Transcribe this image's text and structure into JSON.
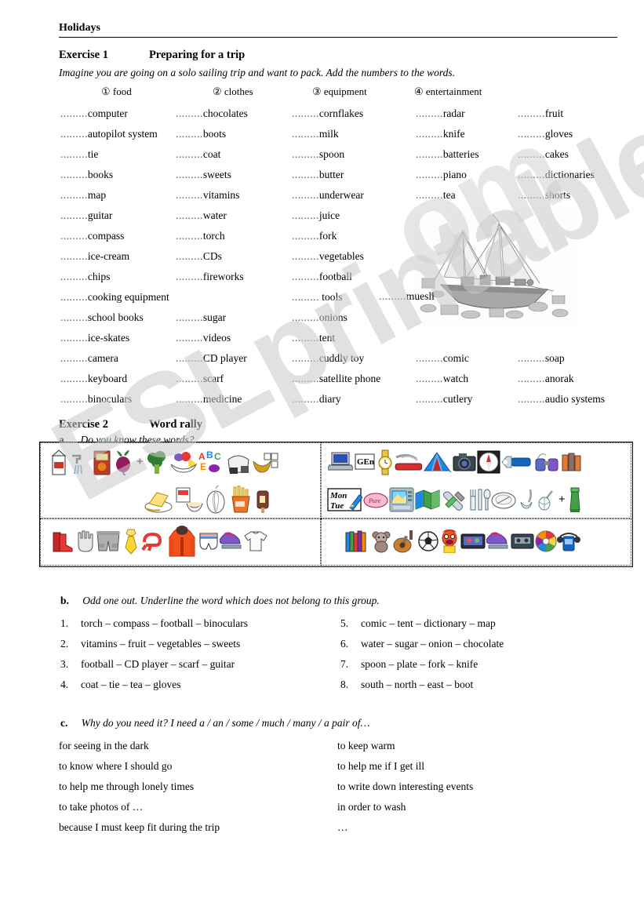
{
  "header": {
    "title": "Holidays"
  },
  "exercise1": {
    "label": "Exercise 1",
    "title": "Preparing for a trip",
    "instruction": "Imagine you are going on a solo sailing trip and want to pack.  Add the numbers to the words.",
    "categories": [
      {
        "num": "①",
        "label": "food"
      },
      {
        "num": "②",
        "label": "clothes"
      },
      {
        "num": "③",
        "label": "equipment"
      },
      {
        "num": "④",
        "label": "entertainment"
      }
    ],
    "dots": ".........",
    "columns": [
      [
        "computer",
        "autopilot system",
        "tie",
        "books",
        "map",
        "guitar",
        "compass",
        "ice-cream",
        "chips",
        "cooking equipment",
        "school books",
        "ice-skates",
        "camera",
        "keyboard",
        "binoculars"
      ],
      [
        "chocolates",
        "boots",
        "coat",
        "sweets",
        "vitamins",
        "water",
        "torch",
        "CDs",
        "fireworks",
        "",
        "sugar",
        "videos",
        "CD player",
        "scarf",
        "medicine"
      ],
      [
        "cornflakes",
        "milk",
        "spoon",
        "butter",
        "underwear",
        "juice",
        "fork",
        "vegetables",
        "football",
        " tools",
        "onions",
        "tent",
        "cuddly toy",
        "satellite phone",
        "diary"
      ],
      [
        "radar",
        "knife",
        "batteries",
        "piano",
        "tea",
        "",
        "",
        "",
        "",
        "",
        "",
        "",
        "comic",
        "watch",
        "cutlery"
      ],
      [
        "fruit",
        "gloves",
        "cakes",
        "dictionaries",
        "shorts",
        "",
        "",
        "",
        "",
        "",
        "",
        "",
        "soap",
        "anorak",
        "audio systems"
      ]
    ],
    "boat_caption": "muesli"
  },
  "exercise2": {
    "label": "Exercise 2",
    "title": "Word rally",
    "part_a": {
      "letter": "a.",
      "prompt": "Do you know these words?"
    },
    "picture_groups": [
      {
        "name": "food",
        "row1": [
          "milk-carton-icon",
          "tap-water-icon",
          "juice-box-icon",
          "beetroot-icon",
          "broccoli-icon",
          "fruit-bowl-icon",
          "sweets-icon",
          "bread-icon",
          "sugar-cubes-icon"
        ],
        "row2": [
          "butter-icon",
          "cereal-bowl-icon",
          "onion-icon",
          "chips-icon",
          "ice-cream-icon"
        ]
      },
      {
        "name": "equipment",
        "row1": [
          "laptop-icon",
          "dictionary-icon",
          "watch-icon",
          "pocket-knife-icon",
          "tent-icon",
          "camera-icon",
          "compass-icon",
          "torch-icon",
          "binoculars-icon",
          "batteries-icon"
        ],
        "row2": [
          "diary-icon",
          "soap-icon",
          "gps-icon",
          "map-icon",
          "tools-icon",
          "cutlery-icon",
          "plate-icon",
          "ladle-icon",
          "whisk-icon",
          "lighthouse-icon"
        ]
      },
      {
        "name": "clothes",
        "row1": [
          "boots-icon",
          "glove-icon",
          "shorts-icon",
          "tie-icon",
          "scarf-icon",
          "anorak-icon",
          "underwear-icon",
          "ice-skates-icon",
          "t-shirt-icon"
        ],
        "row2": []
      },
      {
        "name": "entertainment",
        "row1": [
          "books-icon",
          "teddy-bear-icon",
          "guitar-icon",
          "football-icon",
          "comic-figure-icon",
          "video-icon",
          "ice-skates-icon",
          "cassette-icon",
          "cd-icon",
          "walkman-icon"
        ],
        "row2": []
      }
    ],
    "part_b": {
      "letter": "b.",
      "prompt": "Odd one out.  Underline the word which does not belong to this group.",
      "items_left": [
        {
          "num": "1.",
          "text": "torch – compass – football – binoculars"
        },
        {
          "num": "2.",
          "text": "vitamins – fruit – vegetables – sweets"
        },
        {
          "num": "3.",
          "text": "football – CD player – scarf – guitar"
        },
        {
          "num": "4.",
          "text": "coat – tie – tea – gloves"
        }
      ],
      "items_right": [
        {
          "num": "5.",
          "text": "comic – tent – dictionary – map"
        },
        {
          "num": "6.",
          "text": "water – sugar – onion – chocolate"
        },
        {
          "num": "7.",
          "text": "spoon – plate – fork – knife"
        },
        {
          "num": "8.",
          "text": "south – north – east – boot"
        }
      ]
    },
    "part_c": {
      "letter": "c.",
      "prompt": "Why do you need it? I need a / an / some / much / many / a pair of…",
      "items_left": [
        "for seeing in the dark",
        "to know where I should go",
        "to help me through lonely times",
        "to take photos of …",
        "because I must keep fit during the trip"
      ],
      "items_right": [
        "to keep warm",
        "to help me if I get ill",
        "to write down interesting events",
        "in order to wash",
        "…"
      ]
    }
  },
  "watermark": {
    "text": "ESLprintables.",
    "text2": "om"
  }
}
